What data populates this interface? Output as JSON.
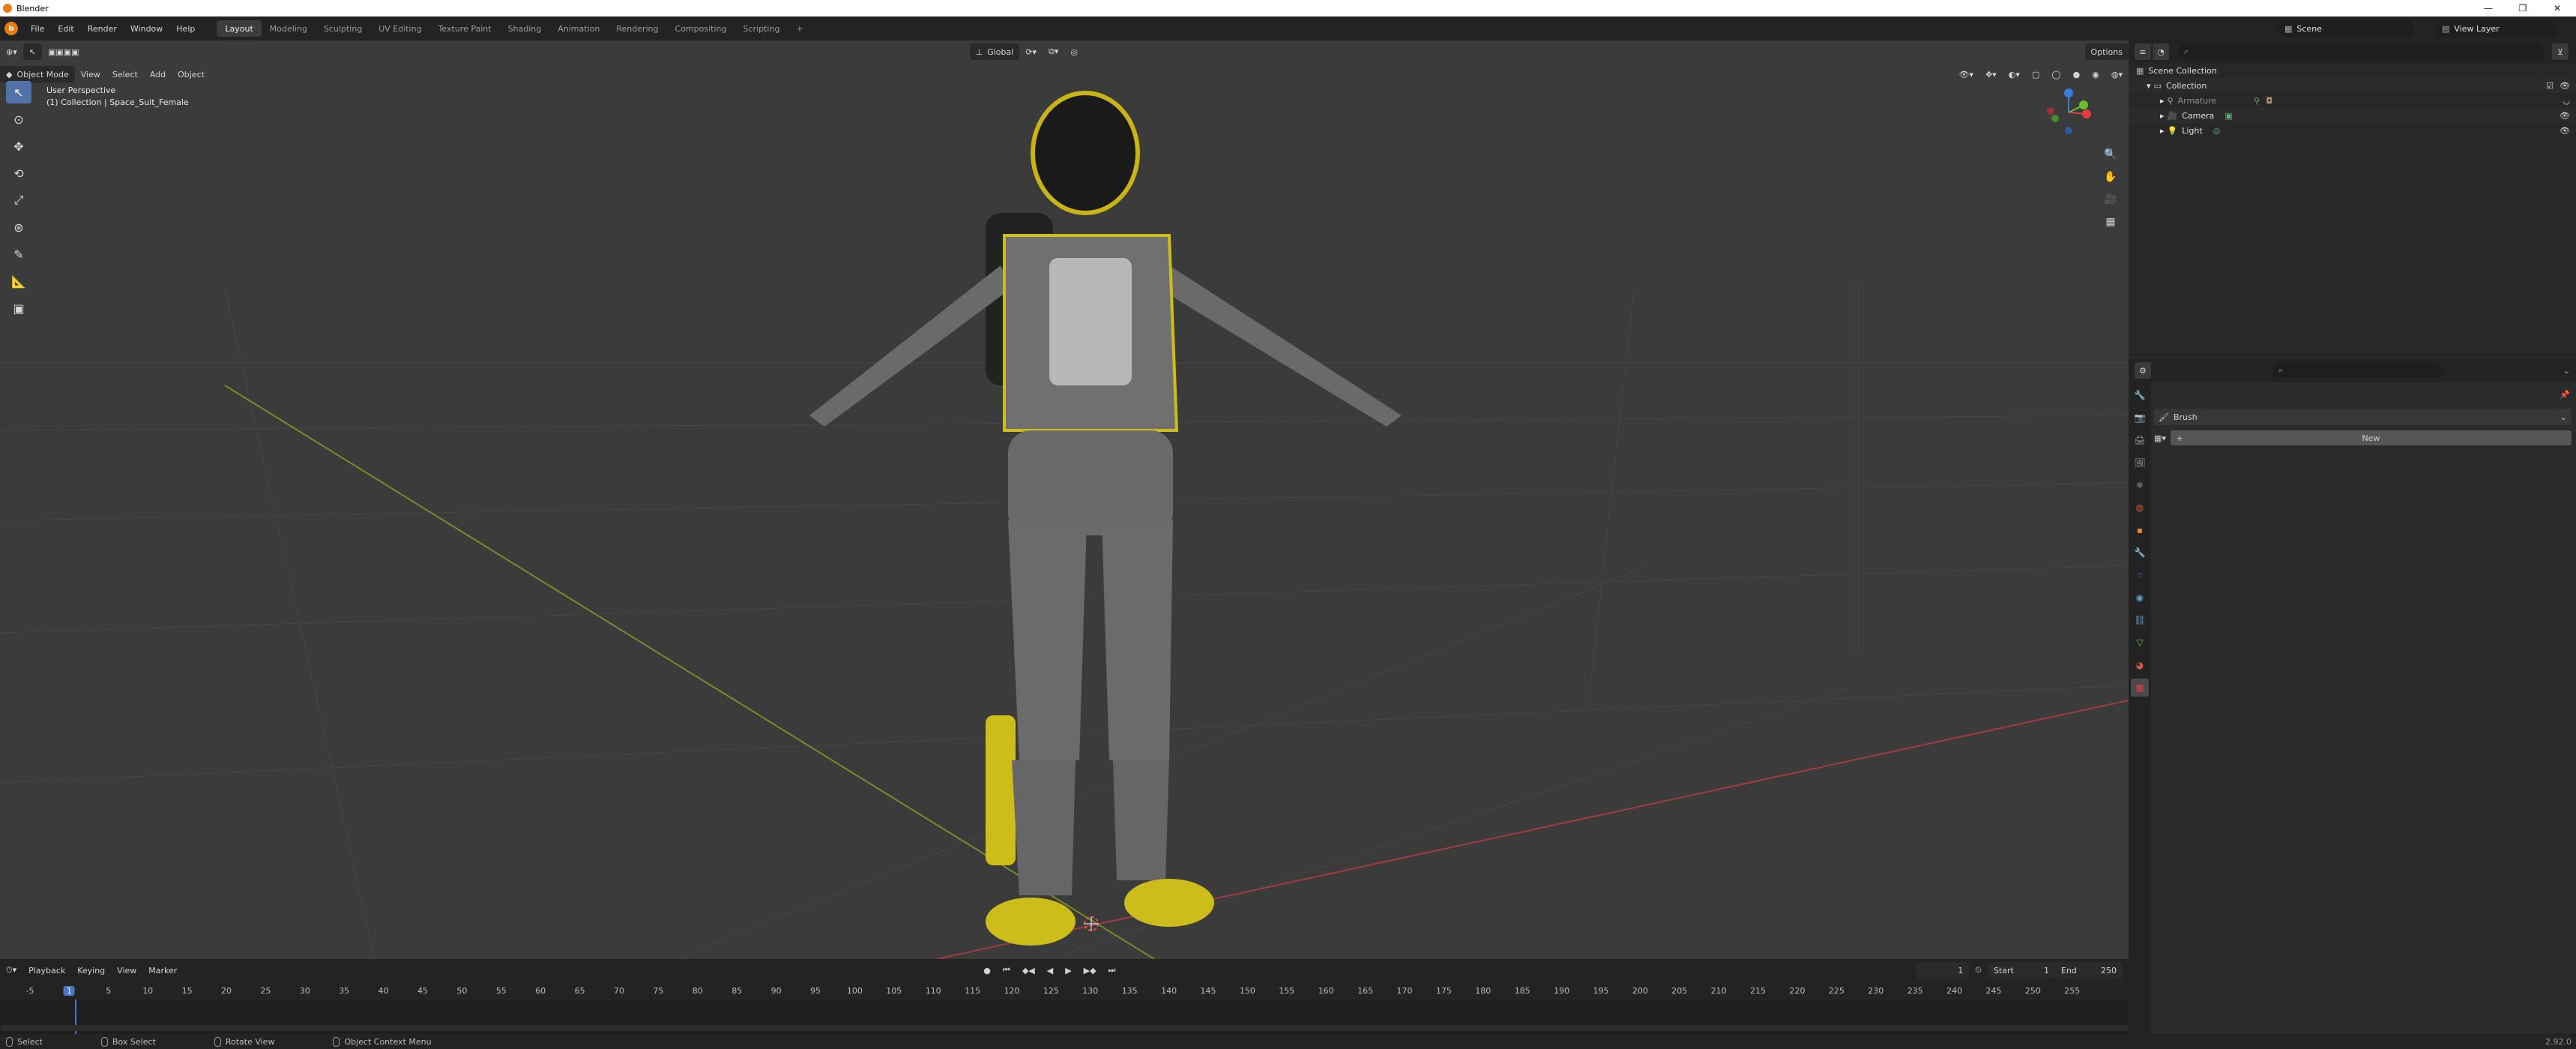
{
  "window": {
    "title": "Blender"
  },
  "menubar": {
    "items": [
      "File",
      "Edit",
      "Render",
      "Window",
      "Help"
    ],
    "workspaces": [
      "Layout",
      "Modeling",
      "Sculpting",
      "UV Editing",
      "Texture Paint",
      "Shading",
      "Animation",
      "Rendering",
      "Compositing",
      "Scripting"
    ],
    "active_workspace": "Layout",
    "add_workspace": "+",
    "scene_name": "Scene",
    "view_layer": "View Layer"
  },
  "viewport": {
    "mode": "Object Mode",
    "menus": [
      "View",
      "Select",
      "Add",
      "Object"
    ],
    "transform_orientation": "Global",
    "options": "Options",
    "perspective_label": "User Perspective",
    "collection_label": "(1) Collection | Space_Suit_Female"
  },
  "outliner": {
    "root": "Scene Collection",
    "collection": "Collection",
    "items": [
      {
        "name": "Armature",
        "color": "#8e8e8e"
      },
      {
        "name": "Camera",
        "color": "#d8d8d8"
      },
      {
        "name": "Light",
        "color": "#d8d8d8"
      }
    ]
  },
  "properties": {
    "brush_label": "Brush",
    "new_button": "New",
    "tab_colors": [
      "#9a9a9a",
      "#9a9a9a",
      "#9a9a9a",
      "#9a9a9a",
      "#c8c8c8",
      "#d0592c",
      "#e3873d",
      "#6e9fd6",
      "#5a7fd0",
      "#5fa3c6",
      "#6cc05a",
      "#d05a4a",
      "#e04040"
    ]
  },
  "timeline": {
    "menus": [
      "Playback",
      "Keying",
      "View",
      "Marker"
    ],
    "current_frame": "1",
    "start_label": "Start",
    "start_value": "1",
    "end_label": "End",
    "end_value": "250",
    "ticks": [
      "-5",
      "1",
      "5",
      "10",
      "15",
      "20",
      "25",
      "30",
      "35",
      "40",
      "45",
      "50",
      "55",
      "60",
      "65",
      "70",
      "75",
      "80",
      "85",
      "90",
      "95",
      "100",
      "105",
      "110",
      "115",
      "120",
      "125",
      "130",
      "135",
      "140",
      "145",
      "150",
      "155",
      "160",
      "165",
      "170",
      "175",
      "180",
      "185",
      "190",
      "195",
      "200",
      "205",
      "210",
      "215",
      "220",
      "225",
      "230",
      "235",
      "240",
      "245",
      "250",
      "255"
    ]
  },
  "statusbar": {
    "select": "Select",
    "box_select": "Box Select",
    "rotate_view": "Rotate View",
    "context_menu": "Object Context Menu",
    "version": "2.92.0"
  }
}
